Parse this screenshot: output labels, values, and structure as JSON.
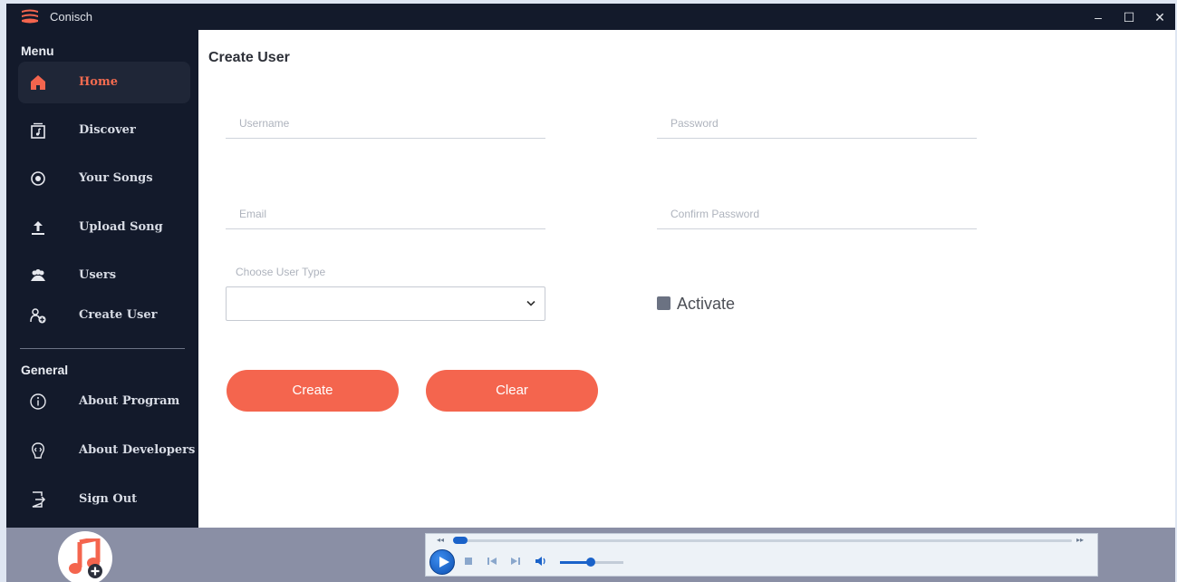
{
  "app": {
    "title": "Conisch"
  },
  "window_controls": {
    "minimize": "–",
    "maximize": "☐",
    "close": "✕"
  },
  "sidebar": {
    "menu_title": "Menu",
    "menu_items": [
      {
        "label": "Home",
        "icon": "home-icon",
        "active": true
      },
      {
        "label": "Discover",
        "icon": "music-note-box-icon",
        "active": false
      },
      {
        "label": "Your Songs",
        "icon": "record-icon",
        "active": false
      },
      {
        "label": "Upload Song",
        "icon": "upload-icon",
        "active": false
      },
      {
        "label": "Users",
        "icon": "users-icon",
        "active": false
      },
      {
        "label": "Create User",
        "icon": "add-user-icon",
        "active": false
      }
    ],
    "general_title": "General",
    "general_items": [
      {
        "label": "About Program",
        "icon": "info-icon"
      },
      {
        "label": "About Developers",
        "icon": "developer-icon"
      },
      {
        "label": "Sign Out",
        "icon": "sign-out-icon"
      }
    ]
  },
  "main": {
    "title": "Create User",
    "fields": {
      "username": {
        "placeholder": "Username",
        "value": ""
      },
      "password": {
        "placeholder": "Password",
        "value": ""
      },
      "email": {
        "placeholder": "Email",
        "value": ""
      },
      "confirm_password": {
        "placeholder": "Confirm Password",
        "value": ""
      }
    },
    "user_type": {
      "label": "Choose User Type",
      "selected": ""
    },
    "activate": {
      "label": "Activate",
      "checked": false
    },
    "buttons": {
      "create": "Create",
      "clear": "Clear"
    }
  },
  "colors": {
    "accent": "#f4654e",
    "sidebar_bg": "#131a2b",
    "bottom_bar": "#8a8fa5",
    "player_blue": "#1a62c9"
  },
  "player": {
    "progress": 0.0,
    "volume": 0.5
  }
}
